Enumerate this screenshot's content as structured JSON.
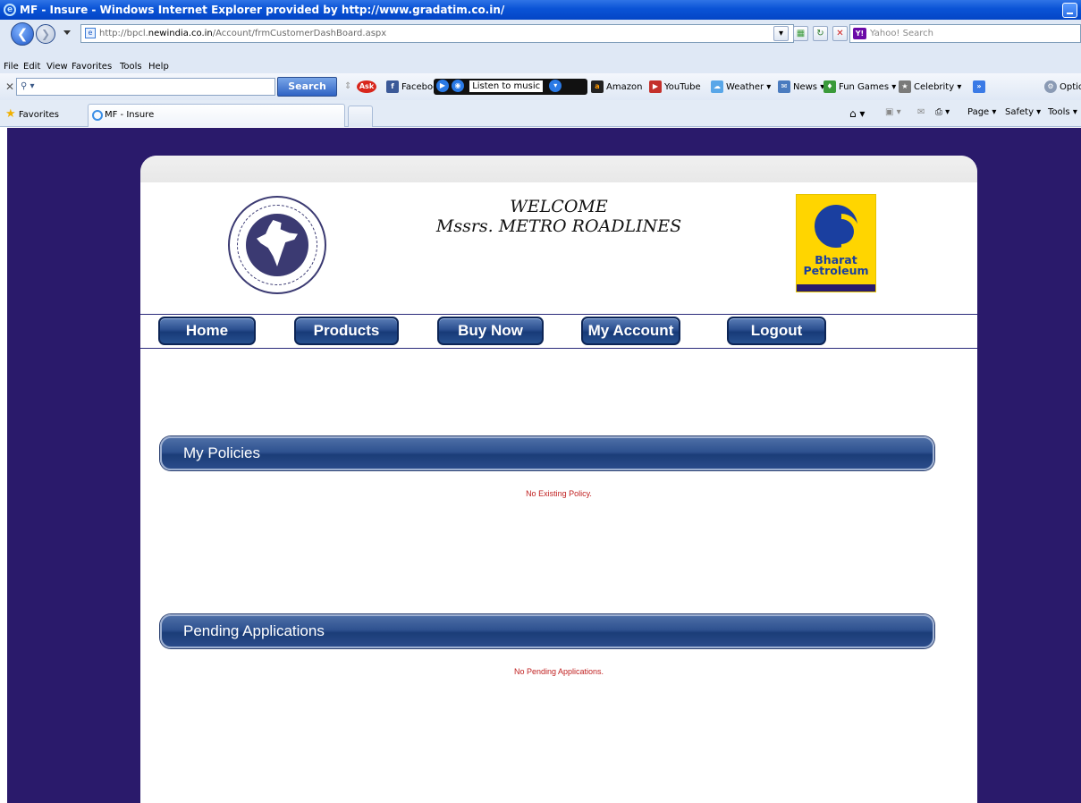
{
  "window": {
    "title": "MF - Insure - Windows Internet Explorer provided by http://www.gradatim.co.in/"
  },
  "address_bar": {
    "url_prefix": "http://bpcl.",
    "url_domain": "newindia.co.in",
    "url_path": "/Account/frmCustomerDashBoard.aspx"
  },
  "search_provider": {
    "placeholder": "Yahoo! Search"
  },
  "menu": [
    "File",
    "Edit",
    "View",
    "Favorites",
    "Tools",
    "Help"
  ],
  "toolbar": {
    "search_button": "Search",
    "facebook": "Facebook",
    "listen": "Listen to music",
    "amazon": "Amazon",
    "youtube": "YouTube",
    "weather": "Weather",
    "news": "News",
    "fun_games": "Fun Games",
    "celebrity": "Celebrity",
    "options": "Optio"
  },
  "tabs": {
    "favorites": "Favorites",
    "active_tab": "MF - Insure"
  },
  "command_bar": {
    "page": "Page",
    "safety": "Safety",
    "tools": "Tools"
  },
  "header": {
    "welcome": "WELCOME",
    "customer": "Mssrs. METRO ROADLINES",
    "partner_logo": "Bharat Petroleum"
  },
  "nav": [
    "Home",
    "Products",
    "Buy Now",
    "My Account",
    "Logout"
  ],
  "sections": [
    {
      "title": "My Policies",
      "message": "No Existing Policy."
    },
    {
      "title": "Pending Applications",
      "message": "No Pending Applications."
    }
  ],
  "colors": {
    "viewport_bg": "#2a1a6b",
    "button_blue": "#1b3d78",
    "notice_red": "#c02020"
  }
}
